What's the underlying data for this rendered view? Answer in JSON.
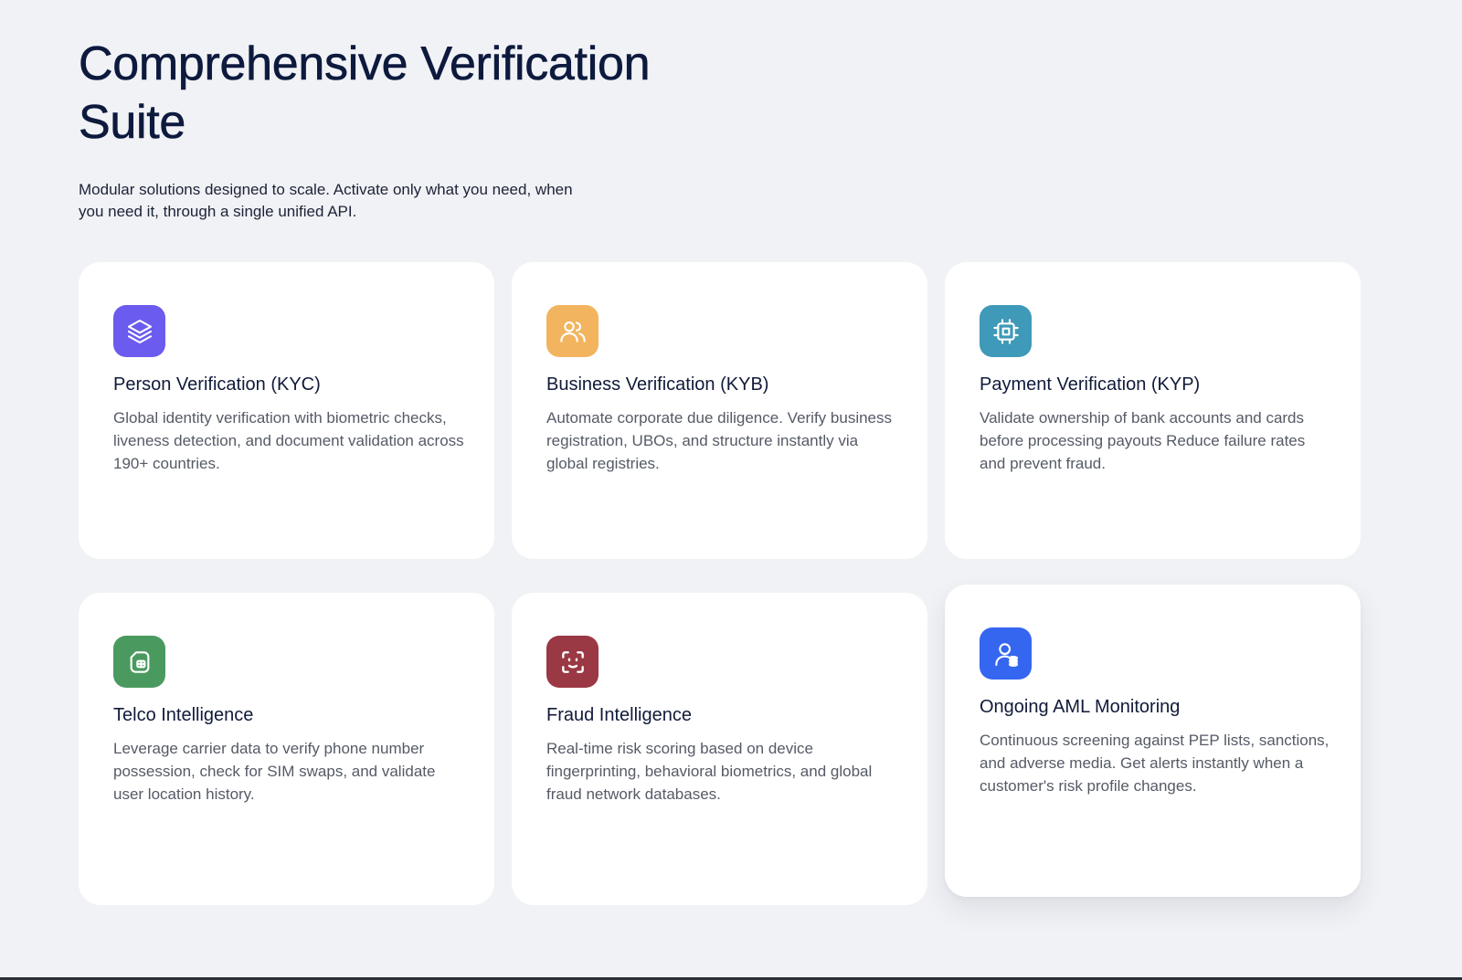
{
  "header": {
    "title": "Comprehensive Verification Suite",
    "subtitle": "Modular solutions designed to scale. Activate only what you need, when you need it, through a single unified API."
  },
  "cards": [
    {
      "title": "Person Verification (KYC)",
      "description": "Global identity verification with biometric checks, liveness detection, and document validation across 190+ countries.",
      "icon": "layers-icon",
      "color": "#6b5bee"
    },
    {
      "title": "Business Verification (KYB)",
      "description": "Automate corporate due diligence. Verify business registration, UBOs, and structure instantly via global registries.",
      "icon": "users-icon",
      "color": "#f2b45e"
    },
    {
      "title": "Payment Verification (KYP)",
      "description": "Validate ownership of bank accounts and cards before processing payouts Reduce failure rates and prevent fraud.",
      "icon": "cpu-icon",
      "color": "#3f99b8"
    },
    {
      "title": "Telco Intelligence",
      "description": "Leverage carrier data to verify phone number possession, check for SIM swaps, and validate user location history.",
      "icon": "sim-card-icon",
      "color": "#4a9a5f"
    },
    {
      "title": "Fraud Intelligence",
      "description": "Real-time risk scoring based on device fingerprinting, behavioral biometrics, and global fraud network databases.",
      "icon": "face-scan-icon",
      "color": "#9a3843"
    },
    {
      "title": "Ongoing AML Monitoring",
      "description": "Continuous screening against PEP lists, sanctions, and adverse media. Get alerts instantly when a customer's risk profile changes.",
      "icon": "user-coins-icon",
      "color": "#3566f0"
    }
  ]
}
